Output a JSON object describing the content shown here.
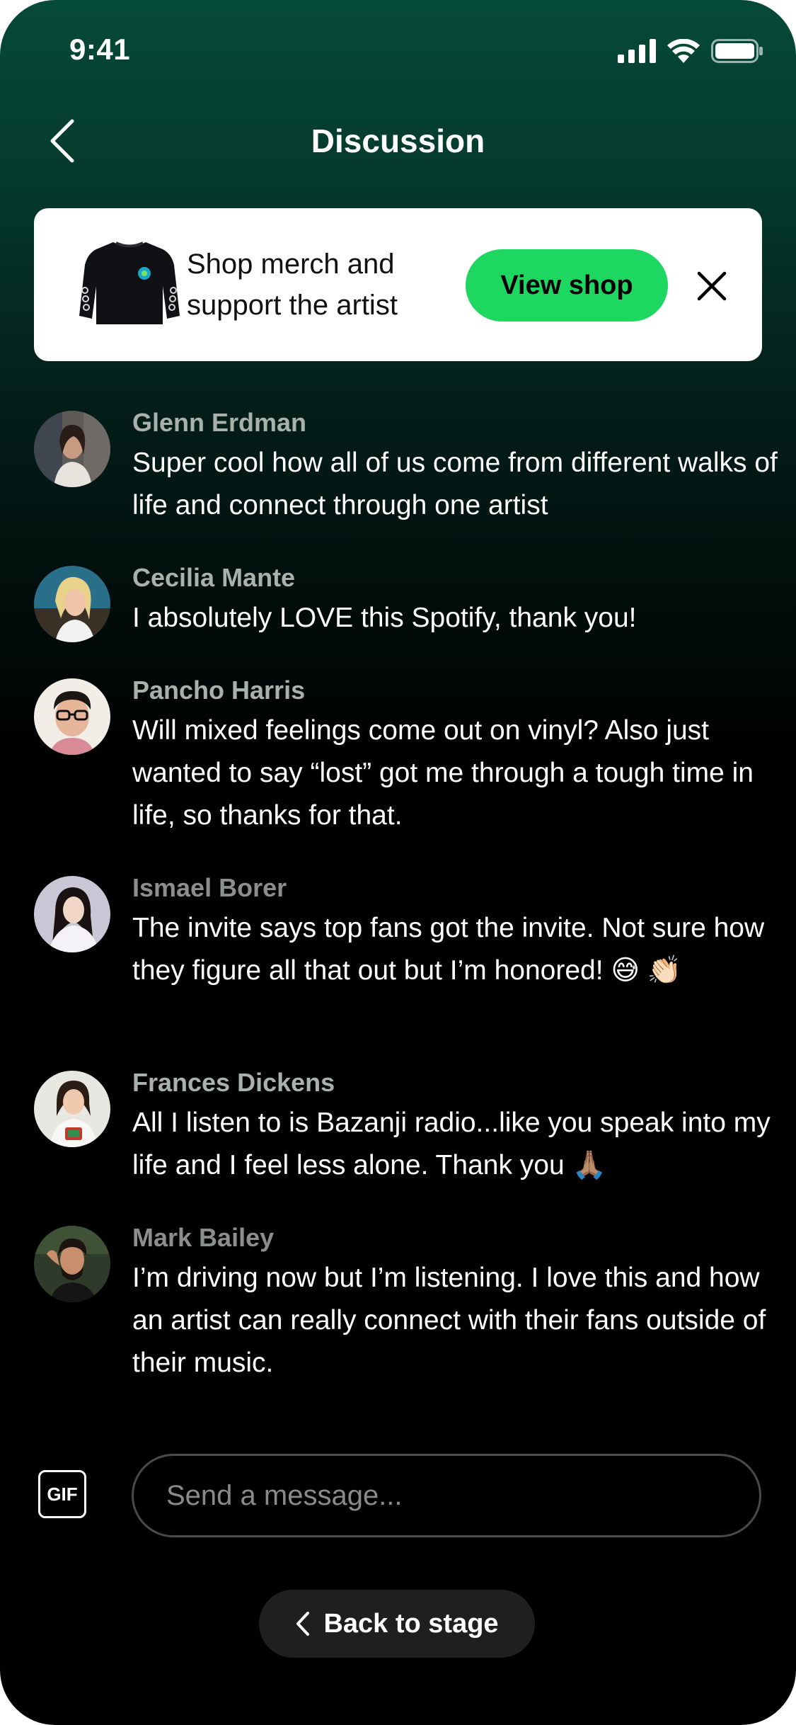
{
  "status_bar": {
    "time": "9:41"
  },
  "header": {
    "title": "Discussion"
  },
  "merch_banner": {
    "text": "Shop merch and support the artist",
    "button_label": "View shop"
  },
  "messages": [
    {
      "name": "Glenn Erdman",
      "text": "Super cool how all of us come from different walks of life and connect through one artist"
    },
    {
      "name": "Cecilia Mante",
      "text": "I absolutely LOVE this Spotify, thank you!"
    },
    {
      "name": "Pancho Harris",
      "text": "Will mixed feelings come out on vinyl? Also just wanted to say “lost” got me through a tough time in life, so thanks for that."
    },
    {
      "name": "Ismael Borer",
      "text": "The invite says top fans got the invite. Not sure how they figure all that out but I’m honored! 😅 👏🏻"
    },
    {
      "name": "Frances Dickens",
      "text": "All I listen to is Bazanji radio...like you speak into my life and I feel less alone. Thank you 🙏🏽"
    },
    {
      "name": "Mark Bailey",
      "text": "I’m driving now but I’m listening. I love this and how an artist can really connect with their fans outside of their music."
    }
  ],
  "composer": {
    "gif_label": "GIF",
    "placeholder": "Send a message..."
  },
  "footer": {
    "back_to_stage_label": "Back to stage"
  },
  "colors": {
    "accent": "#1ed760",
    "gradient_top": "#054a38",
    "background": "#000000",
    "name_text": "#a9b1ac"
  },
  "icons": {
    "back": "chevron-left-icon",
    "close": "close-icon",
    "signal": "cellular-signal-icon",
    "wifi": "wifi-icon",
    "battery": "battery-icon",
    "stage_back": "chevron-left-icon"
  }
}
